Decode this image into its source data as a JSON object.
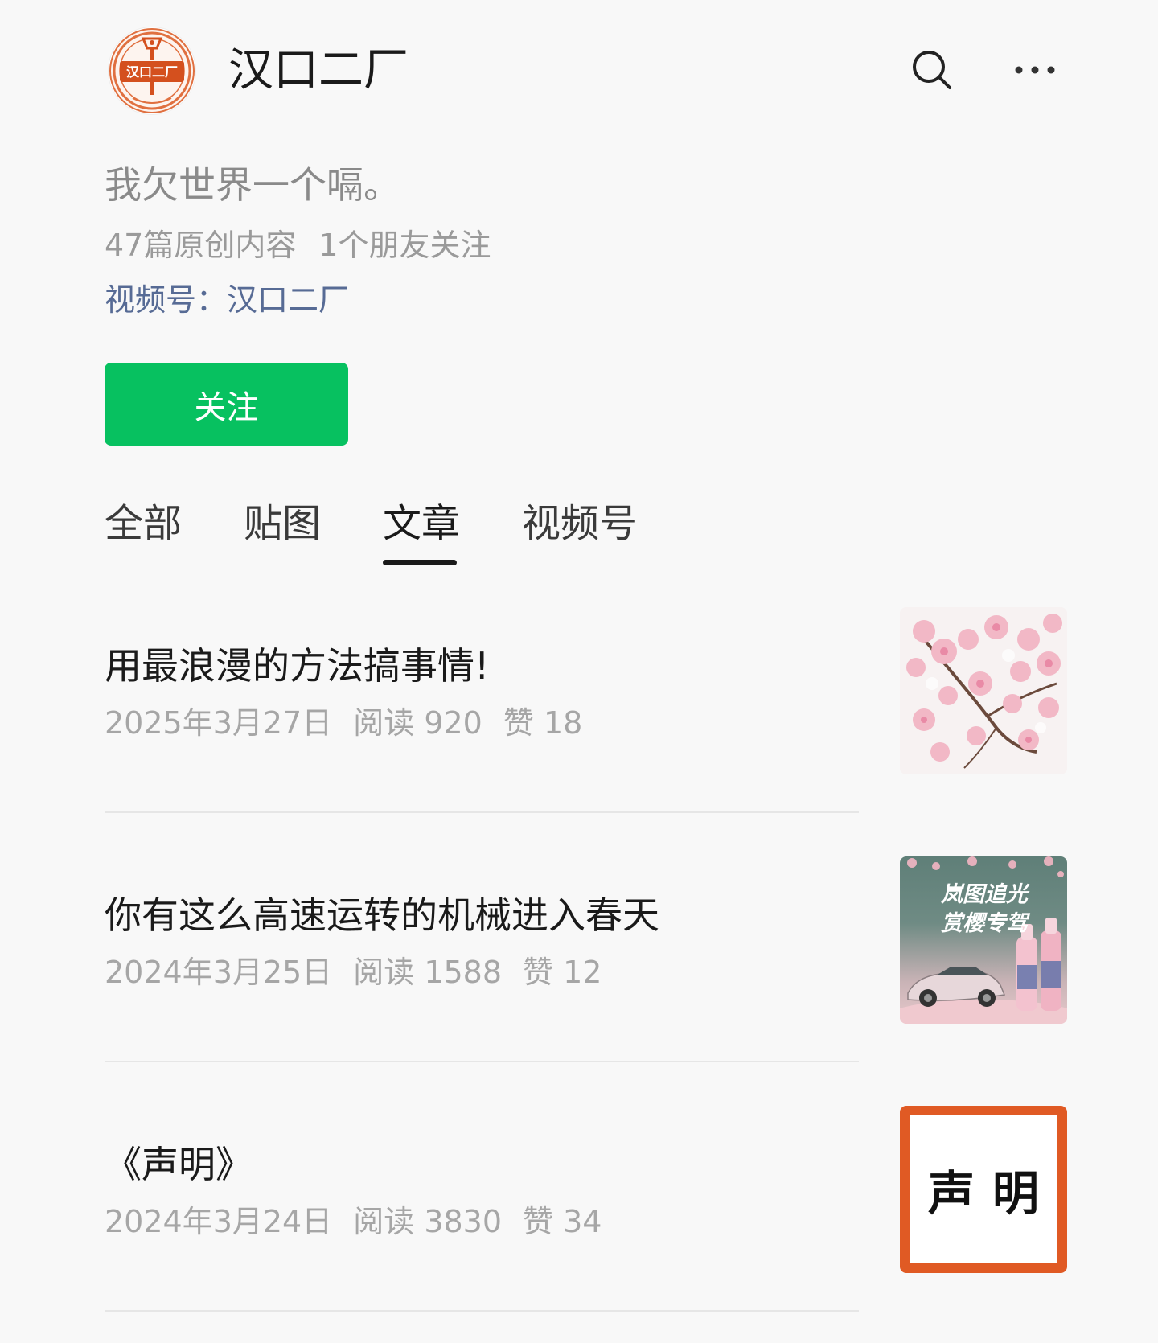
{
  "account": {
    "name": "汉口二厂",
    "avatar_icon": "brand-logo-icon",
    "avatar_logo_text": "汉口二厂",
    "signature": "我欠世界一个嗝。",
    "original_count": "47篇原创内容",
    "friends_following": "1个朋友关注",
    "channel": "视频号：汉口二厂"
  },
  "header": {
    "search_icon": "search-icon",
    "more_icon": "more-icon"
  },
  "follow_button": {
    "label": "关注",
    "color": "#07c160"
  },
  "tabs": [
    {
      "label": "全部",
      "active": false
    },
    {
      "label": "贴图",
      "active": false
    },
    {
      "label": "文章",
      "active": true
    },
    {
      "label": "视频号",
      "active": false
    }
  ],
  "articles": [
    {
      "title": "用最浪漫的方法搞事情!",
      "date": "2025年3月27日",
      "reads": "阅读 920",
      "likes": "赞 18",
      "thumb_icon": "cherry-blossom-image"
    },
    {
      "title": "你有这么高速运转的机械进入春天",
      "date": "2024年3月25日",
      "reads": "阅读 1588",
      "likes": "赞 12",
      "thumb_icon": "car-and-bottles-image",
      "thumb_text_line1": "岚图追光",
      "thumb_text_line2": "赏樱专驾"
    },
    {
      "title": "《声明》",
      "date": "2024年3月24日",
      "reads": "阅读 3830",
      "likes": "赞 34",
      "thumb_icon": "notice-image",
      "thumb_text": "声明",
      "thumb_border_color": "#e05a24"
    }
  ],
  "colors": {
    "background": "#f8f8f8",
    "link": "#576b95",
    "accent": "#07c160"
  }
}
